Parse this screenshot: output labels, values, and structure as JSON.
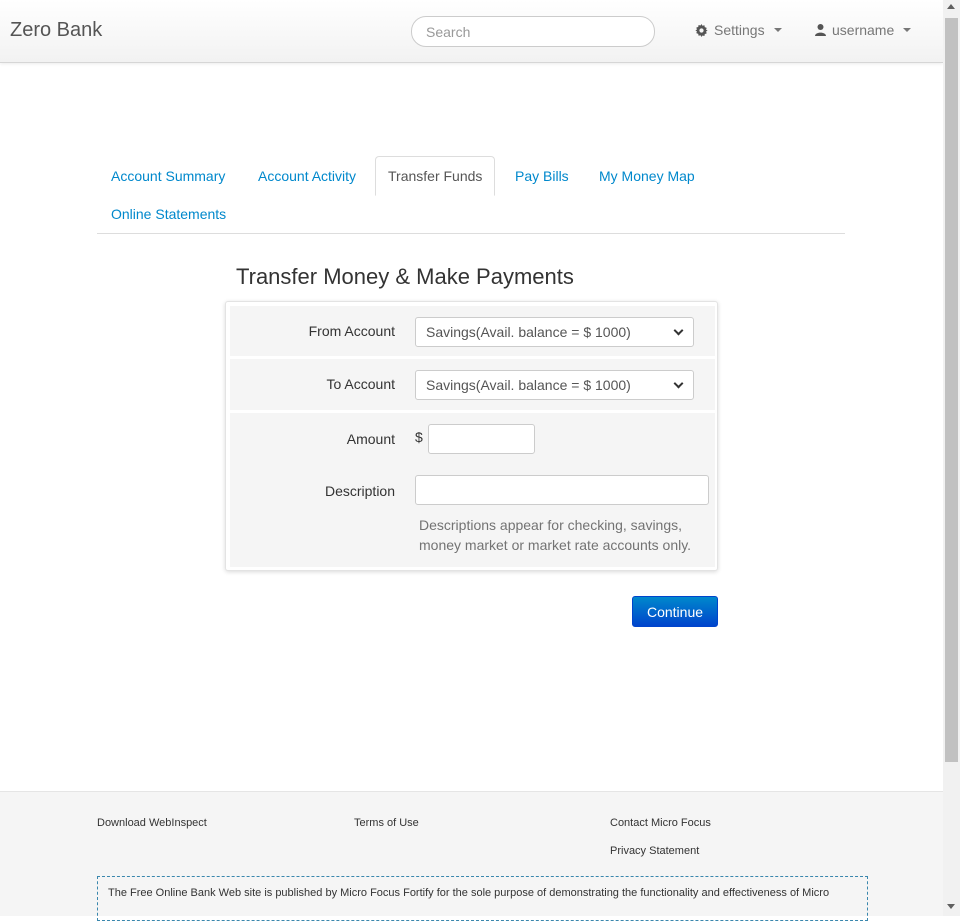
{
  "navbar": {
    "brand": "Zero Bank",
    "search_placeholder": "Search",
    "settings_label": "Settings",
    "user_label": "username"
  },
  "tabs": [
    {
      "label": "Account Summary",
      "active": false
    },
    {
      "label": "Account Activity",
      "active": false
    },
    {
      "label": "Transfer Funds",
      "active": true
    },
    {
      "label": "Pay Bills",
      "active": false
    },
    {
      "label": "My Money Map",
      "active": false
    },
    {
      "label": "Online Statements",
      "active": false
    }
  ],
  "page_title": "Transfer Money & Make Payments",
  "form": {
    "from_label": "From Account",
    "from_value": "Savings(Avail. balance = $ 1000)",
    "to_label": "To Account",
    "to_value": "Savings(Avail. balance = $ 1000)",
    "amount_label": "Amount",
    "currency_symbol": "$",
    "amount_value": "",
    "description_label": "Description",
    "description_value": "",
    "description_help": "Descriptions appear for checking, savings, money market or market rate accounts only."
  },
  "continue_label": "Continue",
  "footer": {
    "download": "Download WebInspect",
    "terms": "Terms of Use",
    "contact": "Contact Micro Focus",
    "privacy": "Privacy Statement",
    "disclaimer": "The Free Online Bank Web site is published by Micro Focus Fortify for the sole purpose of demonstrating the functionality and effectiveness of Micro"
  },
  "colors": {
    "link": "#0088cc",
    "button": "#0055cc"
  },
  "icons": [
    "gear-icon",
    "user-icon",
    "caret-down-icon",
    "chevron-down-icon"
  ]
}
